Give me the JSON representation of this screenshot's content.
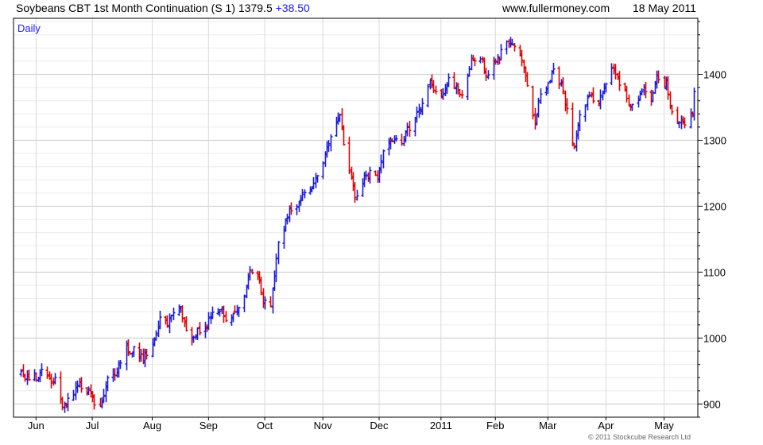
{
  "header": {
    "instrument": "Soybeans CBT 1st Month Continuation (S 1)",
    "last": "1379.5",
    "change": "+38.50",
    "site": "www.fullermoney.com",
    "date": "18 May 2011"
  },
  "copyright": "© 2011 Stockcube Research Ltd",
  "colors": {
    "up": "#1a1add",
    "down": "#e00000",
    "grid": "#d9d9d9",
    "frame": "#000000"
  },
  "chart_data": {
    "type": "ohlc",
    "period_label": "Daily",
    "y_ticks": [
      900,
      1000,
      1100,
      1200,
      1300,
      1400
    ],
    "ylim": [
      880,
      1485
    ],
    "x_tick_labels": [
      "Jun",
      "Jul",
      "Aug",
      "Sep",
      "Oct",
      "Nov",
      "Dec",
      "2011",
      "Feb",
      "Mar",
      "Apr",
      "May"
    ],
    "x_tick_dates": [
      "2010-06-01",
      "2010-07-01",
      "2010-08-02",
      "2010-09-01",
      "2010-10-01",
      "2010-11-01",
      "2010-12-01",
      "2011-01-03",
      "2011-02-01",
      "2011-03-01",
      "2011-04-01",
      "2011-05-02"
    ],
    "xlim": [
      "2010-05-20",
      "2011-05-20"
    ],
    "path_points": [
      [
        "2010-05-24",
        945
      ],
      [
        "2010-05-28",
        938
      ],
      [
        "2010-06-04",
        946
      ],
      [
        "2010-06-08",
        934
      ],
      [
        "2010-06-11",
        940
      ],
      [
        "2010-06-15",
        895
      ],
      [
        "2010-06-18",
        905
      ],
      [
        "2010-06-25",
        930
      ],
      [
        "2010-06-29",
        918
      ],
      [
        "2010-07-02",
        905
      ],
      [
        "2010-07-06",
        898
      ],
      [
        "2010-07-09",
        935
      ],
      [
        "2010-07-14",
        950
      ],
      [
        "2010-07-19",
        985
      ],
      [
        "2010-07-23",
        980
      ],
      [
        "2010-07-28",
        970
      ],
      [
        "2010-08-03",
        1000
      ],
      [
        "2010-08-06",
        1030
      ],
      [
        "2010-08-10",
        1020
      ],
      [
        "2010-08-13",
        1045
      ],
      [
        "2010-08-17",
        1040
      ],
      [
        "2010-08-20",
        1010
      ],
      [
        "2010-08-24",
        1002
      ],
      [
        "2010-08-27",
        1015
      ],
      [
        "2010-08-31",
        1020
      ],
      [
        "2010-09-03",
        1040
      ],
      [
        "2010-09-08",
        1045
      ],
      [
        "2010-09-10",
        1030
      ],
      [
        "2010-09-15",
        1040
      ],
      [
        "2010-09-20",
        1070
      ],
      [
        "2010-09-23",
        1105
      ],
      [
        "2010-09-27",
        1100
      ],
      [
        "2010-09-30",
        1060
      ],
      [
        "2010-10-04",
        1055
      ],
      [
        "2010-10-08",
        1140
      ],
      [
        "2010-10-12",
        1180
      ],
      [
        "2010-10-15",
        1195
      ],
      [
        "2010-10-20",
        1210
      ],
      [
        "2010-10-25",
        1230
      ],
      [
        "2010-10-29",
        1240
      ],
      [
        "2010-11-03",
        1285
      ],
      [
        "2010-11-08",
        1320
      ],
      [
        "2010-11-10",
        1340
      ],
      [
        "2010-11-12",
        1290
      ],
      [
        "2010-11-16",
        1250
      ],
      [
        "2010-11-18",
        1215
      ],
      [
        "2010-11-22",
        1240
      ],
      [
        "2010-11-26",
        1250
      ],
      [
        "2010-11-30",
        1245
      ],
      [
        "2010-12-03",
        1285
      ],
      [
        "2010-12-08",
        1300
      ],
      [
        "2010-12-13",
        1295
      ],
      [
        "2010-12-16",
        1315
      ],
      [
        "2010-12-21",
        1340
      ],
      [
        "2010-12-28",
        1385
      ],
      [
        "2011-01-03",
        1370
      ],
      [
        "2011-01-07",
        1390
      ],
      [
        "2011-01-11",
        1380
      ],
      [
        "2011-01-14",
        1365
      ],
      [
        "2011-01-19",
        1425
      ],
      [
        "2011-01-24",
        1420
      ],
      [
        "2011-01-28",
        1395
      ],
      [
        "2011-02-02",
        1425
      ],
      [
        "2011-02-07",
        1445
      ],
      [
        "2011-02-10",
        1450
      ],
      [
        "2011-02-14",
        1435
      ],
      [
        "2011-02-17",
        1400
      ],
      [
        "2011-02-22",
        1330
      ],
      [
        "2011-02-25",
        1365
      ],
      [
        "2011-03-02",
        1395
      ],
      [
        "2011-03-04",
        1415
      ],
      [
        "2011-03-08",
        1380
      ],
      [
        "2011-03-11",
        1345
      ],
      [
        "2011-03-15",
        1285
      ],
      [
        "2011-03-18",
        1335
      ],
      [
        "2011-03-23",
        1365
      ],
      [
        "2011-03-28",
        1360
      ],
      [
        "2011-03-31",
        1375
      ],
      [
        "2011-04-04",
        1415
      ],
      [
        "2011-04-08",
        1390
      ],
      [
        "2011-04-12",
        1365
      ],
      [
        "2011-04-15",
        1350
      ],
      [
        "2011-04-20",
        1375
      ],
      [
        "2011-04-25",
        1365
      ],
      [
        "2011-04-28",
        1395
      ],
      [
        "2011-05-03",
        1385
      ],
      [
        "2011-05-06",
        1345
      ],
      [
        "2011-05-10",
        1330
      ],
      [
        "2011-05-13",
        1325
      ],
      [
        "2011-05-17",
        1340
      ],
      [
        "2011-05-18",
        1380
      ]
    ]
  }
}
